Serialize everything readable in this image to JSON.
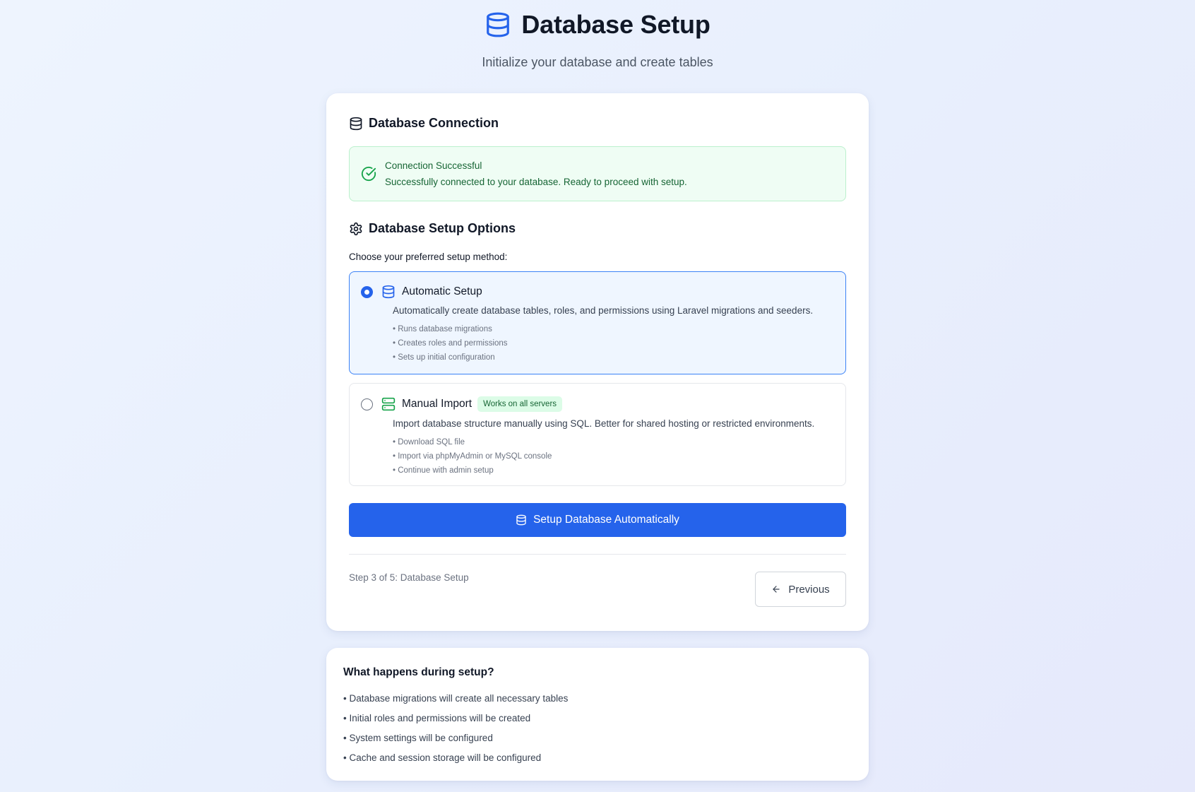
{
  "header": {
    "title": "Database Setup",
    "subtitle": "Initialize your database and create tables",
    "icon": "database-icon"
  },
  "connection": {
    "heading": "Database Connection",
    "alert_title": "Connection Successful",
    "alert_message": "Successfully connected to your database. Ready to proceed with setup.",
    "status_color": "#16a34a"
  },
  "setup_options": {
    "heading": "Database Setup Options",
    "choose_label": "Choose your preferred setup method:",
    "options": [
      {
        "title": "Automatic Setup",
        "selected": true,
        "icon": "database-icon",
        "description": "Automatically create database tables, roles, and permissions using Laravel migrations and seeders.",
        "bullets": [
          "Runs database migrations",
          "Creates roles and permissions",
          "Sets up initial configuration"
        ]
      },
      {
        "title": "Manual Import",
        "selected": false,
        "icon": "server-icon",
        "badge": "Works on all servers",
        "description": "Import database structure manually using SQL. Better for shared hosting or restricted environments.",
        "bullets": [
          "Download SQL file",
          "Import via phpMyAdmin or MySQL console",
          "Continue with admin setup"
        ]
      }
    ]
  },
  "actions": {
    "primary_label": "Setup Database Automatically",
    "step_text": "Step 3 of 5: Database Setup",
    "previous_label": "Previous",
    "accent_color": "#2563eb"
  },
  "info": {
    "title": "What happens during setup?",
    "items": [
      "Database migrations will create all necessary tables",
      "Initial roles and permissions will be created",
      "System settings will be configured",
      "Cache and session storage will be configured"
    ]
  }
}
